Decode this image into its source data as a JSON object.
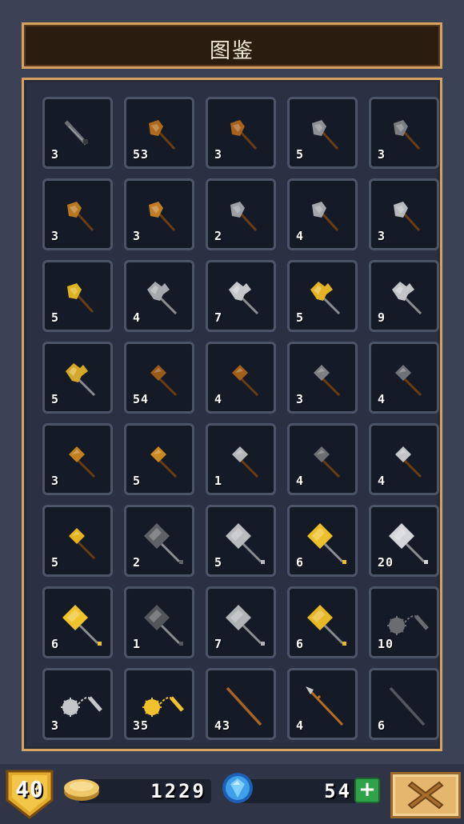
{
  "header": {
    "title": "图鉴"
  },
  "collection": {
    "items": [
      {
        "icon": "dagger-icon",
        "color": "#6c6f73",
        "count": "3"
      },
      {
        "icon": "axe-icon",
        "color": "#b06a1a",
        "count": "53"
      },
      {
        "icon": "axe-icon",
        "color": "#a7621c",
        "count": "3"
      },
      {
        "icon": "axe-icon",
        "color": "#8d8f93",
        "count": "5"
      },
      {
        "icon": "axe-icon",
        "color": "#7b7d80",
        "count": "3"
      },
      {
        "icon": "axe-icon",
        "color": "#b8781f",
        "count": "3"
      },
      {
        "icon": "axe-icon",
        "color": "#c07d24",
        "count": "3"
      },
      {
        "icon": "axe-icon",
        "color": "#9c9fa3",
        "count": "2"
      },
      {
        "icon": "axe-icon",
        "color": "#a3a6aa",
        "count": "4"
      },
      {
        "icon": "axe-icon",
        "color": "#b5b8bc",
        "count": "3"
      },
      {
        "icon": "axe-icon",
        "color": "#e0b21f",
        "count": "5"
      },
      {
        "icon": "battleaxe-icon",
        "color": "#a5a8ac",
        "count": "4"
      },
      {
        "icon": "battleaxe-icon",
        "color": "#c4c6ca",
        "count": "7"
      },
      {
        "icon": "battleaxe-icon",
        "color": "#e3b323",
        "count": "5"
      },
      {
        "icon": "battleaxe-icon",
        "color": "#c2c4c8",
        "count": "9"
      },
      {
        "icon": "battleaxe-icon",
        "color": "#d4a92a",
        "count": "5"
      },
      {
        "icon": "hammer-icon",
        "color": "#9a5a16",
        "count": "54"
      },
      {
        "icon": "hammer-icon",
        "color": "#a0601a",
        "count": "4"
      },
      {
        "icon": "hammer-icon",
        "color": "#7e8084",
        "count": "3"
      },
      {
        "icon": "hammer-icon",
        "color": "#6f7276",
        "count": "4"
      },
      {
        "icon": "hammer-icon",
        "color": "#c2801f",
        "count": "3"
      },
      {
        "icon": "hammer-icon",
        "color": "#c98a22",
        "count": "5"
      },
      {
        "icon": "hammer-icon",
        "color": "#b4b6ba",
        "count": "1"
      },
      {
        "icon": "hammer-icon",
        "color": "#6c6e72",
        "count": "4"
      },
      {
        "icon": "hammer-icon",
        "color": "#c3c5c9",
        "count": "4"
      },
      {
        "icon": "hammer-icon",
        "color": "#e6b420",
        "count": "5"
      },
      {
        "icon": "warhammer-icon",
        "color": "#5f6166",
        "count": "2"
      },
      {
        "icon": "warhammer-icon",
        "color": "#b9bbbf",
        "count": "5"
      },
      {
        "icon": "warhammer-icon",
        "color": "#edc02a",
        "count": "6"
      },
      {
        "icon": "warhammer-icon",
        "color": "#d3d5d8",
        "count": "20"
      },
      {
        "icon": "warhammer-icon",
        "color": "#f0c22b",
        "count": "6"
      },
      {
        "icon": "warhammer-icon",
        "color": "#54565b",
        "count": "1"
      },
      {
        "icon": "warhammer-icon",
        "color": "#b1b3b7",
        "count": "7"
      },
      {
        "icon": "warhammer-icon",
        "color": "#e8b926",
        "count": "6"
      },
      {
        "icon": "flail-icon",
        "color": "#6a6c71",
        "count": "10"
      },
      {
        "icon": "flail-icon",
        "color": "#c4c6ca",
        "count": "3"
      },
      {
        "icon": "flail-icon",
        "color": "#f1c22c",
        "count": "35"
      },
      {
        "icon": "staff-icon",
        "color": "#a86224",
        "count": "43"
      },
      {
        "icon": "spear-icon",
        "color": "#b86c22",
        "count": "4"
      },
      {
        "icon": "staff-icon",
        "color": "#54575d",
        "count": "6"
      }
    ]
  },
  "footer": {
    "level": "40",
    "coins": "1229",
    "gems": "54",
    "add_label": "+",
    "coin_icon": "gold-coin-icon",
    "gem_icon": "blue-gem-icon",
    "close_icon": "close-icon"
  },
  "colors": {
    "panel_border": "#d7a15f",
    "background": "#3c4256",
    "slot_bg": "#151a27"
  }
}
